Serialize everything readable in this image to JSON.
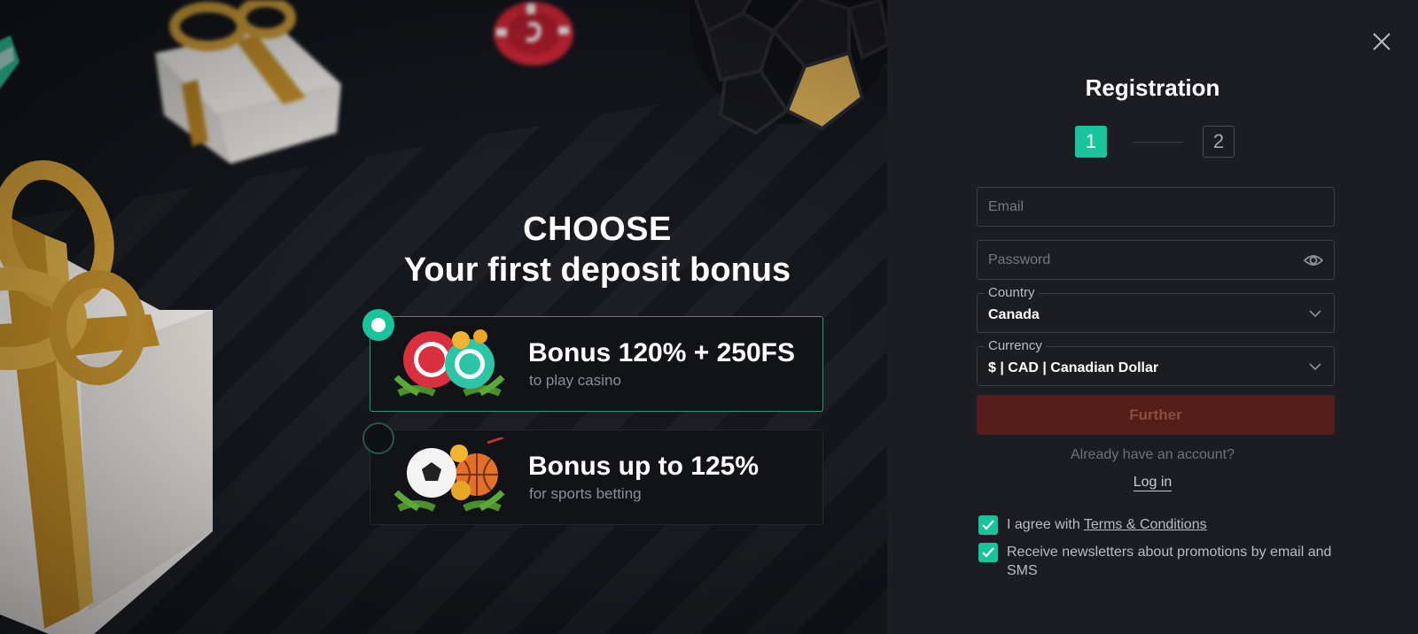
{
  "promo": {
    "heading_line1": "CHOOSE",
    "heading_line2": "Your first deposit bonus",
    "bonuses": [
      {
        "title": "Bonus 120% + 250FS",
        "subtitle": "to play casino",
        "selected": true,
        "icon": "casino-chips-icon"
      },
      {
        "title": "Bonus up to 125%",
        "subtitle": "for sports betting",
        "selected": false,
        "icon": "sports-balls-icon"
      }
    ]
  },
  "registration": {
    "title": "Registration",
    "steps": [
      "1",
      "2"
    ],
    "active_step": 1,
    "email_placeholder": "Email",
    "password_placeholder": "Password",
    "country_label": "Country",
    "country_value": "Canada",
    "currency_label": "Currency",
    "currency_value": "$ | CAD | Canadian Dollar",
    "further_label": "Further",
    "have_account_text": "Already have an account?",
    "login_label": "Log in",
    "agree_prefix": "I agree with ",
    "agree_link": "Terms & Conditions",
    "agree_checked": true,
    "newsletter_text": "Receive newsletters about promotions by email and SMS",
    "newsletter_checked": true
  },
  "colors": {
    "accent": "#17c49c",
    "further_bg": "#541d18",
    "panel_bg": "#1b1d23"
  }
}
